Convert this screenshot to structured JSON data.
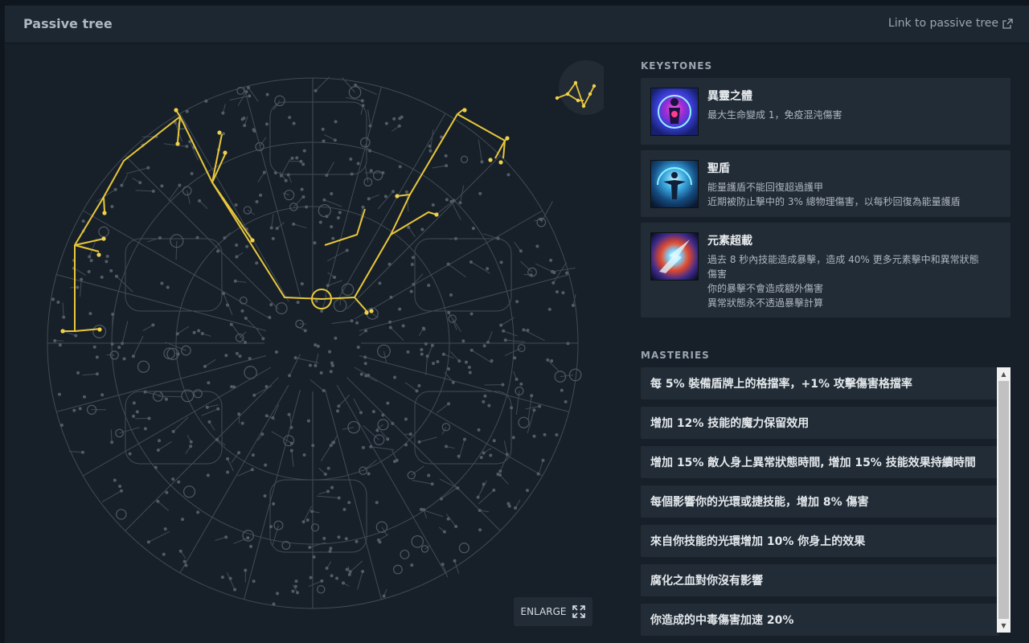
{
  "header": {
    "title": "Passive tree",
    "link_label": "Link to passive tree"
  },
  "tree": {
    "enlarge_label": "ENLARGE"
  },
  "keystones": {
    "label": "KEYSTONES",
    "items": [
      {
        "name": "異靈之體",
        "lines": [
          "最大生命變成 1，免疫混沌傷害"
        ],
        "icon": "chaos-inoculation-icon"
      },
      {
        "name": "聖盾",
        "lines": [
          "能量護盾不能回復超過護甲",
          "近期被防止擊中的 3% 總物理傷害，以每秒回復為能量護盾"
        ],
        "icon": "divine-shield-icon"
      },
      {
        "name": "元素超載",
        "lines": [
          "過去 8 秒內技能造成暴擊，造成 40% 更多元素擊中和異常狀態",
          "傷害",
          "你的暴擊不會造成額外傷害",
          "異常狀態永不透過暴擊計算"
        ],
        "icon": "elemental-overload-icon"
      }
    ]
  },
  "masteries": {
    "label": "MASTERIES",
    "items": [
      "每 5% 裝備盾牌上的格擋率，+1% 攻擊傷害格擋率",
      "增加 12% 技能的魔力保留效用",
      "增加 15% 敵人身上異常狀態時間, 增加 15% 技能效果持續時間",
      "每個影響你的光環或捷技能，增加 8% 傷害",
      "來自你技能的光環增加 10% 你身上的效果",
      "腐化之血對你沒有影響",
      "你造成的中毒傷害加速 20%"
    ]
  },
  "colors": {
    "allocated": "#e8c73a",
    "unallocated": "#4b5560",
    "panel": "#172029",
    "card": "#222c36"
  }
}
